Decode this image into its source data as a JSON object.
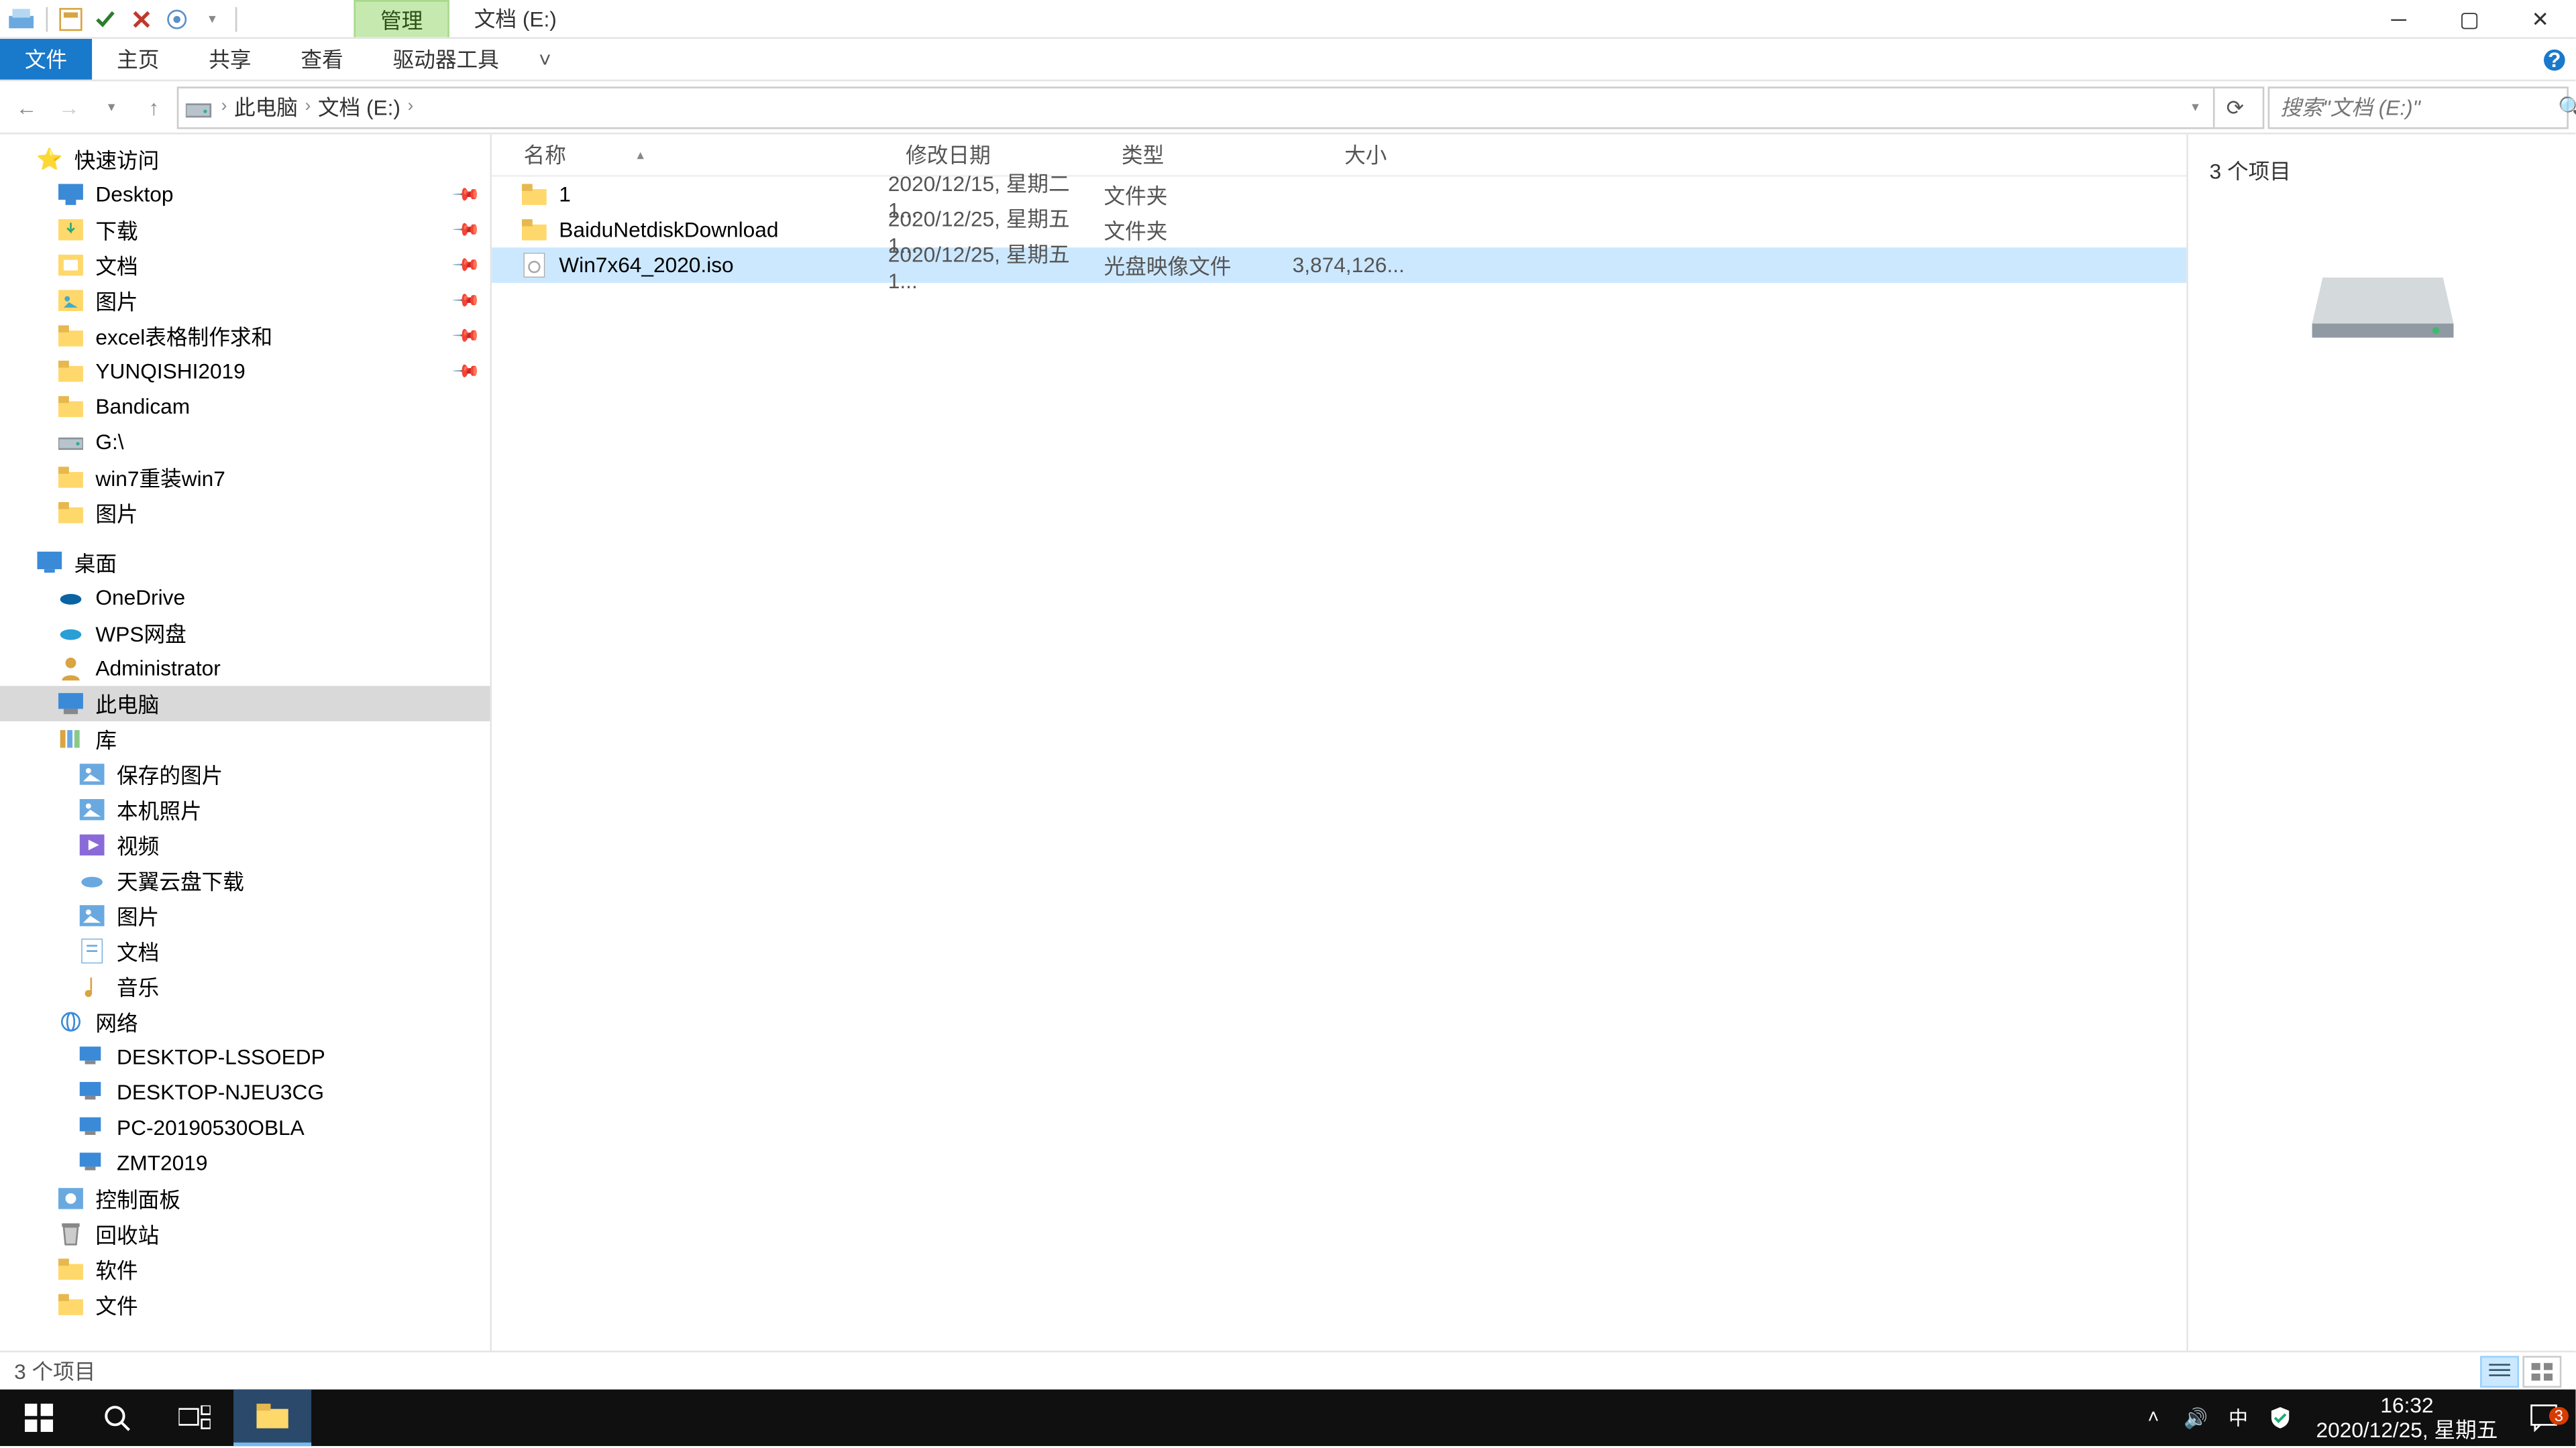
{
  "titlebar": {
    "contextual_tab": "管理",
    "window_title": "文档 (E:)"
  },
  "ribbon": {
    "file": "文件",
    "tabs": [
      "主页",
      "共享",
      "查看",
      "驱动器工具"
    ]
  },
  "breadcrumbs": [
    "此电脑",
    "文档 (E:)"
  ],
  "search": {
    "placeholder": "搜索\"文档 (E:)\""
  },
  "tree": {
    "quick_access": "快速访问",
    "qa_items": [
      {
        "label": "Desktop",
        "icon": "desktop",
        "pinned": true
      },
      {
        "label": "下载",
        "icon": "download",
        "pinned": true
      },
      {
        "label": "文档",
        "icon": "doc",
        "pinned": true
      },
      {
        "label": "图片",
        "icon": "pic",
        "pinned": true
      },
      {
        "label": "excel表格制作求和",
        "icon": "folder",
        "pinned": true
      },
      {
        "label": "YUNQISHI2019",
        "icon": "folder",
        "pinned": true
      },
      {
        "label": "Bandicam",
        "icon": "folder",
        "pinned": false
      },
      {
        "label": "G:\\",
        "icon": "drive",
        "pinned": false
      },
      {
        "label": "win7重装win7",
        "icon": "folder",
        "pinned": false
      },
      {
        "label": "图片",
        "icon": "folder",
        "pinned": false
      }
    ],
    "desktop": "桌面",
    "desktop_items": [
      {
        "label": "OneDrive",
        "icon": "onedrive"
      },
      {
        "label": "WPS网盘",
        "icon": "wps"
      },
      {
        "label": "Administrator",
        "icon": "user"
      },
      {
        "label": "此电脑",
        "icon": "pc",
        "selected": true
      },
      {
        "label": "库",
        "icon": "lib"
      },
      {
        "label": "保存的图片",
        "icon": "picfile"
      },
      {
        "label": "本机照片",
        "icon": "picfile"
      },
      {
        "label": "视频",
        "icon": "video"
      },
      {
        "label": "天翼云盘下载",
        "icon": "cloud"
      },
      {
        "label": "图片",
        "icon": "picfile"
      },
      {
        "label": "文档",
        "icon": "docfile"
      },
      {
        "label": "音乐",
        "icon": "music"
      },
      {
        "label": "网络",
        "icon": "net"
      },
      {
        "label": "DESKTOP-LSSOEDP",
        "icon": "pcnet"
      },
      {
        "label": "DESKTOP-NJEU3CG",
        "icon": "pcnet"
      },
      {
        "label": "PC-20190530OBLA",
        "icon": "pcnet"
      },
      {
        "label": "ZMT2019",
        "icon": "pcnet"
      },
      {
        "label": "控制面板",
        "icon": "cp"
      },
      {
        "label": "回收站",
        "icon": "recycle"
      },
      {
        "label": "软件",
        "icon": "folder"
      },
      {
        "label": "文件",
        "icon": "folder"
      }
    ]
  },
  "columns": {
    "name": "名称",
    "date": "修改日期",
    "type": "类型",
    "size": "大小"
  },
  "files": [
    {
      "name": "1",
      "date": "2020/12/15, 星期二 1...",
      "type": "文件夹",
      "size": "",
      "icon": "folder"
    },
    {
      "name": "BaiduNetdiskDownload",
      "date": "2020/12/25, 星期五 1...",
      "type": "文件夹",
      "size": "",
      "icon": "folder"
    },
    {
      "name": "Win7x64_2020.iso",
      "date": "2020/12/25, 星期五 1...",
      "type": "光盘映像文件",
      "size": "3,874,126...",
      "icon": "iso",
      "selected": true
    }
  ],
  "preview": {
    "title": "3 个项目"
  },
  "statusbar": {
    "text": "3 个项目"
  },
  "taskbar": {
    "time": "16:32",
    "date": "2020/12/25, 星期五",
    "ime": "中",
    "notif_count": "3"
  }
}
